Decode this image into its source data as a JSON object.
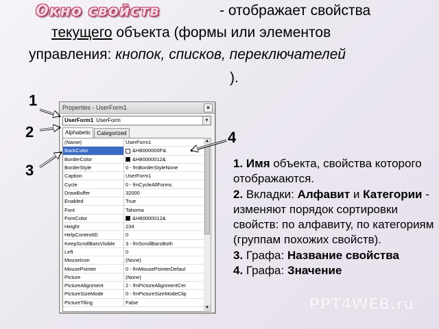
{
  "slide": {
    "title": "Окно свойств",
    "line1": "- отображает свойства",
    "line2_underlined": "текущего",
    "line2_rest": " объекта (формы или элементов",
    "line3_plain": "управления: ",
    "line3_italic": "кнопок, списков, переключателей",
    "line4": ").",
    "labels": [
      "1",
      "2",
      "3",
      "4"
    ]
  },
  "window": {
    "title": "Properties - UserForm1",
    "close_glyph": "×",
    "object_name": "UserForm1",
    "object_type": "UserForm",
    "tabs": [
      "Alphabetic",
      "Categorized"
    ],
    "active_tab": "Alphabetic"
  },
  "properties": [
    {
      "name": "(Name)",
      "value": "UserForm1"
    },
    {
      "name": "BackColor",
      "value": "&H8000000F&",
      "swatch": "#ffffff",
      "selected": true
    },
    {
      "name": "BorderColor",
      "value": "&H80000012&",
      "swatch": "#000000"
    },
    {
      "name": "BorderStyle",
      "value": "0 - fmBorderStyleNone"
    },
    {
      "name": "Caption",
      "value": "UserForm1"
    },
    {
      "name": "Cycle",
      "value": "0 - fmCycleAllForms"
    },
    {
      "name": "DrawBuffer",
      "value": "32000"
    },
    {
      "name": "Enabled",
      "value": "True"
    },
    {
      "name": "Font",
      "value": "Tahoma"
    },
    {
      "name": "ForeColor",
      "value": "&H80000012&",
      "swatch": "#000000"
    },
    {
      "name": "Height",
      "value": "234"
    },
    {
      "name": "HelpContextID",
      "value": "0"
    },
    {
      "name": "KeepScrollBarsVisible",
      "value": "3 - fmScrollBarsBoth"
    },
    {
      "name": "Left",
      "value": "0"
    },
    {
      "name": "MouseIcon",
      "value": "(None)"
    },
    {
      "name": "MousePointer",
      "value": "0 - fmMousePointerDefaul"
    },
    {
      "name": "Picture",
      "value": "(None)"
    },
    {
      "name": "PictureAlignment",
      "value": "2 - fmPictureAlignmentCer"
    },
    {
      "name": "PictureSizeMode",
      "value": "0 - fmPictureSizeModeClip"
    },
    {
      "name": "PictureTiling",
      "value": "False"
    }
  ],
  "explanation": {
    "p1_bold": "1. Имя",
    "p1_rest": " объекта, свойства которого отображаются.",
    "p2_bold": "2.",
    "p2_a": " Вкладки: ",
    "p2_bold2": "Алфавит",
    "p2_b": " и ",
    "p2_bold3": "Категории",
    "p2_rest": " - изменяют порядок сортировки свойств: по алфавиту, по категориям (группам похожих свойств).",
    "p3_bold": "3.",
    "p3_a": " Графа: ",
    "p3_bold2": "Название свойства",
    "p4_bold": "4.",
    "p4_a": " Графа: ",
    "p4_bold2": "Значение"
  },
  "watermark": "PPT4WEB.ru",
  "colors": {
    "title_fill": "#f3d6e0",
    "title_outline": "#b83c63",
    "selected_row": "#3a6ac3"
  }
}
